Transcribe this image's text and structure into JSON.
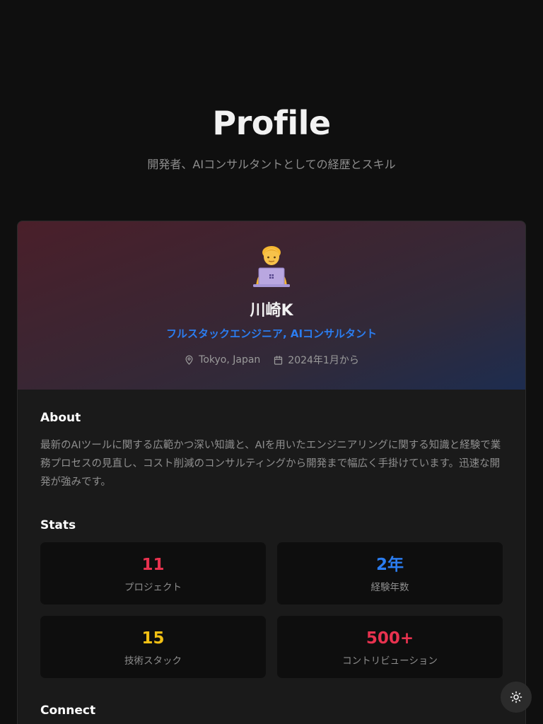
{
  "header": {
    "title": "Profile",
    "subtitle": "開発者、AIコンサルタントとしての経歴とスキル"
  },
  "profile": {
    "avatar_icon": "technologist-emoji",
    "name": "川崎K",
    "role": "フルスタックエンジニア, AIコンサルタント",
    "location": "Tokyo, Japan",
    "since": "2024年1月から"
  },
  "about": {
    "title": "About",
    "text": "最新のAIツールに関する広範かつ深い知識と、AIを用いたエンジニアリングに関する知識と経験で業務プロセスの見直し、コスト削減のコンサルティングから開発まで幅広く手掛けています。迅速な開発が強みです。"
  },
  "stats": {
    "title": "Stats",
    "items": [
      {
        "value": "11",
        "label": "プロジェクト",
        "color": "#e8324f"
      },
      {
        "value": "2年",
        "label": "経験年数",
        "color": "#2b7df0"
      },
      {
        "value": "15",
        "label": "技術スタック",
        "color": "#f2c014"
      },
      {
        "value": "500+",
        "label": "コントリビューション",
        "color": "#e8324f"
      }
    ]
  },
  "connect": {
    "title": "Connect"
  },
  "theme_toggle": {
    "icon": "sun-icon"
  }
}
